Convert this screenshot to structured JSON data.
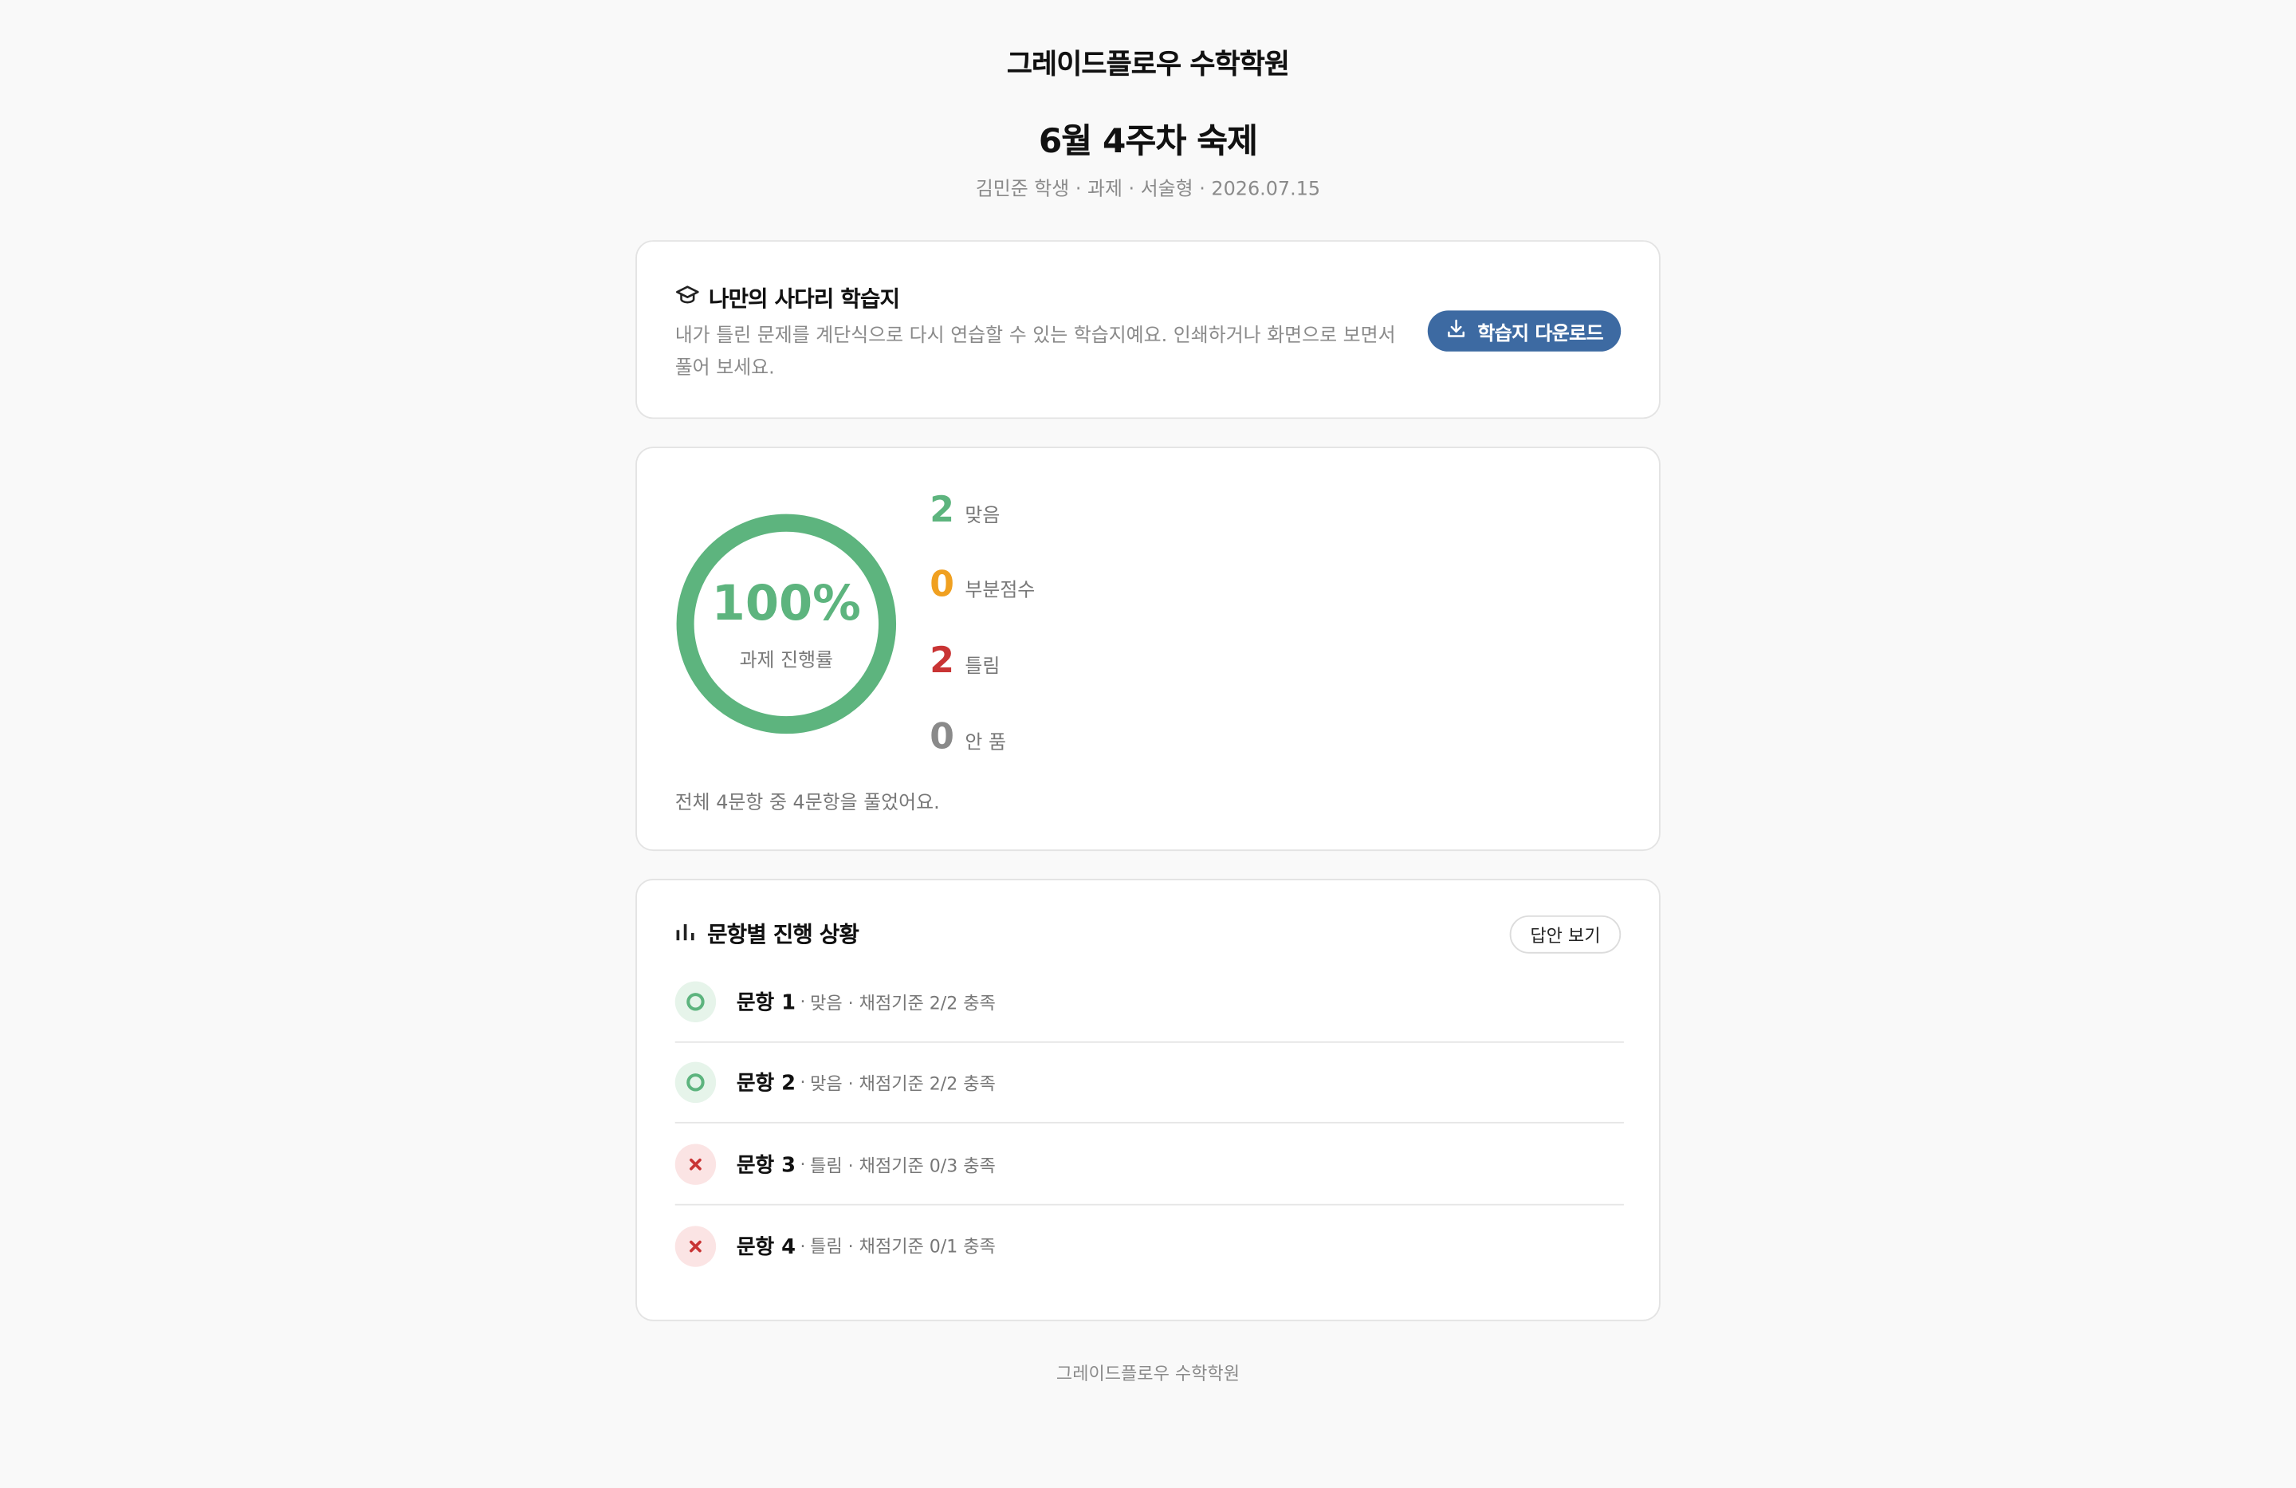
{
  "header": {
    "academy": "그레이드플로우 수학학원",
    "title": "6월 4주차 숙제",
    "meta": "김민준 학생 · 과제 · 서술형 · 2026.07.15"
  },
  "ladder": {
    "icon": "graduation-cap-icon",
    "title": "나만의 사다리 학습지",
    "description": "내가 틀린 문제를 계단식으로 다시 연습할 수 있는 학습지예요. 인쇄하거나 화면으로 보면서 풀어 보세요.",
    "download_icon": "download-icon",
    "download_label": "학습지 다운로드"
  },
  "progress": {
    "percent_text": "100%",
    "percent_value": 100,
    "label": "과제 진행률",
    "stats": [
      {
        "value": "2",
        "label": "맞음",
        "color": "#5db47e"
      },
      {
        "value": "0",
        "label": "부분점수",
        "color": "#f0a020"
      },
      {
        "value": "2",
        "label": "틀림",
        "color": "#c93434"
      },
      {
        "value": "0",
        "label": "안 품",
        "color": "#8a8a8a"
      }
    ],
    "summary": "전체 4문항 중 4문항을 풀었어요."
  },
  "questions": {
    "icon": "bar-chart-icon",
    "title": "문항별 진행 상황",
    "answer_button": "답안 보기",
    "items": [
      {
        "name": "문항 1",
        "sep": "·",
        "info": "맞음 · 채점기준 2/2 충족",
        "status": "correct",
        "status_icon": "circle-icon"
      },
      {
        "name": "문항 2",
        "sep": "·",
        "info": "맞음 · 채점기준 2/2 충족",
        "status": "correct",
        "status_icon": "circle-icon"
      },
      {
        "name": "문항 3",
        "sep": "·",
        "info": "틀림 · 채점기준 0/3 충족",
        "status": "wrong",
        "status_icon": "x-icon"
      },
      {
        "name": "문항 4",
        "sep": "·",
        "info": "틀림 · 채점기준 0/1 충족",
        "status": "wrong",
        "status_icon": "x-icon"
      }
    ]
  },
  "footer": "그레이드플로우 수학학원",
  "colors": {
    "accent": "#3d6aa2",
    "correct": "#5db47e",
    "partial": "#f0a020",
    "wrong": "#c93434",
    "muted": "#8a8a8a"
  }
}
